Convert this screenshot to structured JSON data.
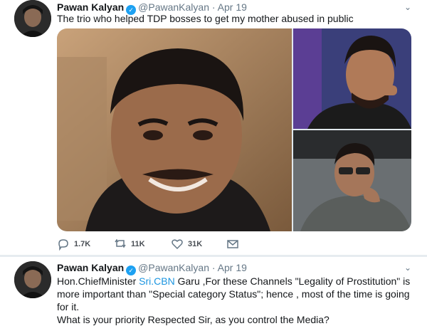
{
  "tweets": [
    {
      "name": "Pawan Kalyan",
      "handle": "@PawanKalyan",
      "separator": "·",
      "date": "Apr 19",
      "text": "The trio who helped TDP bosses to get my mother abused in public",
      "actions": {
        "replies": "1.7K",
        "retweets": "11K",
        "likes": "31K"
      }
    },
    {
      "name": "Pawan Kalyan",
      "handle": "@PawanKalyan",
      "separator": "·",
      "date": "Apr 19",
      "text_before_link": "Hon.ChiefMinister ",
      "link_text": "Sri.CBN",
      "text_after_link": " Garu ,For these Channels \"Legality of Prostitution\" is more important than \"Special category Status\"; hence , most of the time  is going for it.",
      "text_line2": " What is your priority Respected Sir, as you control the Media?"
    }
  ],
  "icons": {
    "verified": "verified-badge-icon",
    "reply": "reply-icon",
    "retweet": "retweet-icon",
    "like": "heart-icon",
    "message": "envelope-icon",
    "more": "chevron-down-icon"
  },
  "colors": {
    "link": "#1b95e0",
    "verified": "#1da1f2",
    "muted": "#657786"
  }
}
